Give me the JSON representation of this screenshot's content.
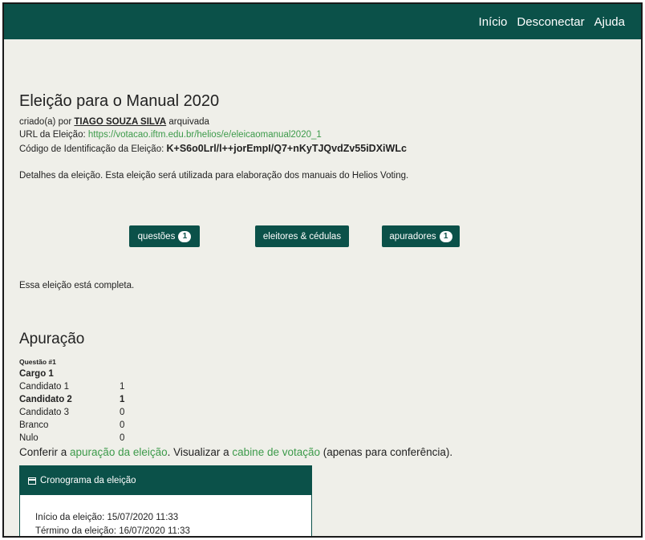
{
  "nav": {
    "home": "Início",
    "logout": "Desconectar",
    "help": "Ajuda"
  },
  "election": {
    "title": "Eleição para o Manual 2020",
    "created_prefix": "criado(a) por",
    "creator": "TIAGO SOUZA SILVA",
    "archived": "arquivada",
    "url_label": "URL da Eleição:",
    "url": "https://votacao.iftm.edu.br/helios/e/eleicaomanual2020_1",
    "code_label": "Código de Identificação da Eleição:",
    "code": "K+S6o0Lrl/l++jorEmpI/Q7+nKyTJQvdZv55iDXiWLc",
    "description": "Detalhes da eleição. Esta eleição será utilizada para elaboração dos manuais do Helios Voting.",
    "complete": "Essa eleição está completa."
  },
  "buttons": {
    "questions": "questões",
    "questions_count": "1",
    "voters": "eleitores & cédulas",
    "trustees": "apuradores",
    "trustees_count": "1"
  },
  "tally": {
    "heading": "Apuração",
    "question_label": "Questão #1",
    "question": "Cargo 1",
    "rows": [
      {
        "name": "Candidato 1",
        "votes": "1"
      },
      {
        "name": "Candidato 2",
        "votes": "1"
      },
      {
        "name": "Candidato 3",
        "votes": "0"
      },
      {
        "name": "Branco",
        "votes": "0"
      },
      {
        "name": "Nulo",
        "votes": "0"
      }
    ],
    "confer_1": "Conferir a ",
    "confer_link1": "apuração da eleição",
    "confer_2": ". Visualizar a ",
    "confer_link2": "cabine de votação",
    "confer_3": " (apenas para conferência)."
  },
  "schedule": {
    "title": "Cronograma da eleição",
    "start": "Início da eleição: 15/07/2020 11:33",
    "end": "Término da eleição: 16/07/2020 11:33"
  }
}
